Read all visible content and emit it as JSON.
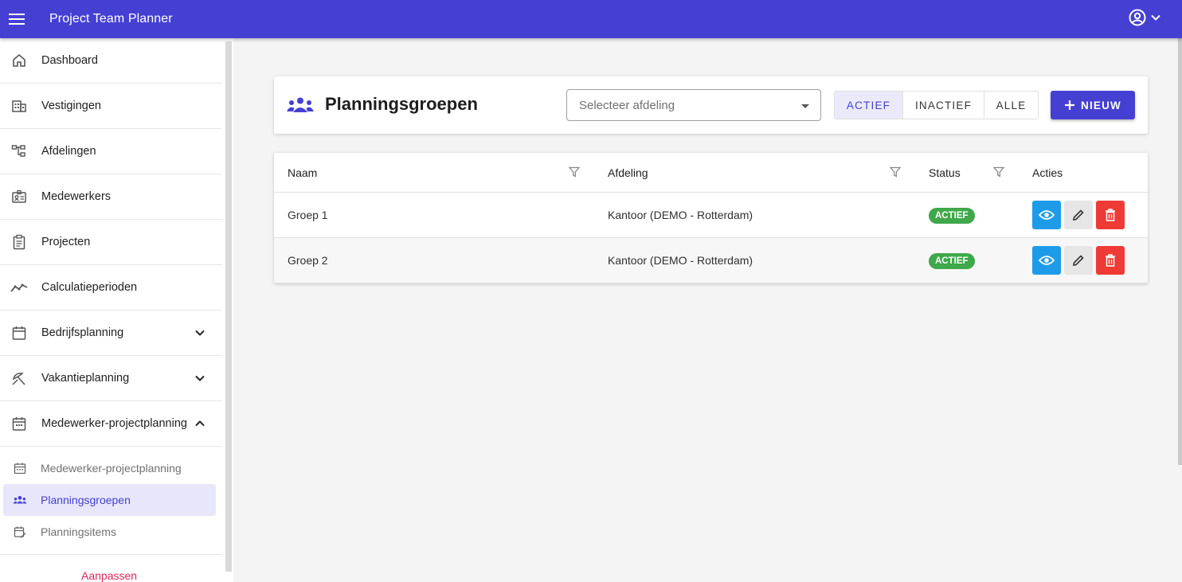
{
  "app": {
    "title": "Project Team Planner"
  },
  "topbar": {
    "menu_icon": "hamburger-icon",
    "user_icon": "account-circle-icon"
  },
  "sidebar": {
    "items": [
      {
        "label": "Dashboard",
        "icon": "home-icon"
      },
      {
        "label": "Vestigingen",
        "icon": "building-icon"
      },
      {
        "label": "Afdelingen",
        "icon": "hierarchy-icon"
      },
      {
        "label": "Medewerkers",
        "icon": "badge-icon"
      },
      {
        "label": "Projecten",
        "icon": "clipboard-icon"
      },
      {
        "label": "Calculatieperioden",
        "icon": "trend-line-icon"
      },
      {
        "label": "Bedrijfsplanning",
        "icon": "calendar-icon",
        "expandable": true,
        "expanded": false
      },
      {
        "label": "Vakantieplanning",
        "icon": "beach-umbrella-icon",
        "expandable": true,
        "expanded": false
      },
      {
        "label": "Medewerker-projectplanning",
        "icon": "calendar-icon",
        "expandable": true,
        "expanded": true
      }
    ],
    "sub_items": [
      {
        "label": "Medewerker-projectplanning",
        "icon": "calendar-icon",
        "active": false
      },
      {
        "label": "Planningsgroepen",
        "icon": "group-icon",
        "active": true
      },
      {
        "label": "Planningsitems",
        "icon": "calendar-edit-icon",
        "active": false
      }
    ],
    "customize_label": "Aanpassen"
  },
  "header": {
    "title": "Planningsgroepen",
    "department_select": {
      "placeholder": "Selecteer afdeling"
    },
    "status_filter": {
      "options": [
        "ACTIEF",
        "INACTIEF",
        "ALLE"
      ],
      "selected": "ACTIEF"
    },
    "new_button": "NIEUW"
  },
  "table": {
    "columns": [
      "Naam",
      "Afdeling",
      "Status",
      "Acties"
    ],
    "rows": [
      {
        "naam": "Groep 1",
        "afdeling": "Kantoor (DEMO - Rotterdam)",
        "status": "ACTIEF"
      },
      {
        "naam": "Groep 2",
        "afdeling": "Kantoor (DEMO - Rotterdam)",
        "status": "ACTIEF"
      }
    ]
  },
  "colors": {
    "primary": "#4540d2",
    "active_badge": "#3ea84a",
    "view_button": "#1e9be8",
    "delete_button": "#ef3b36",
    "customize_link": "#e0245e"
  }
}
